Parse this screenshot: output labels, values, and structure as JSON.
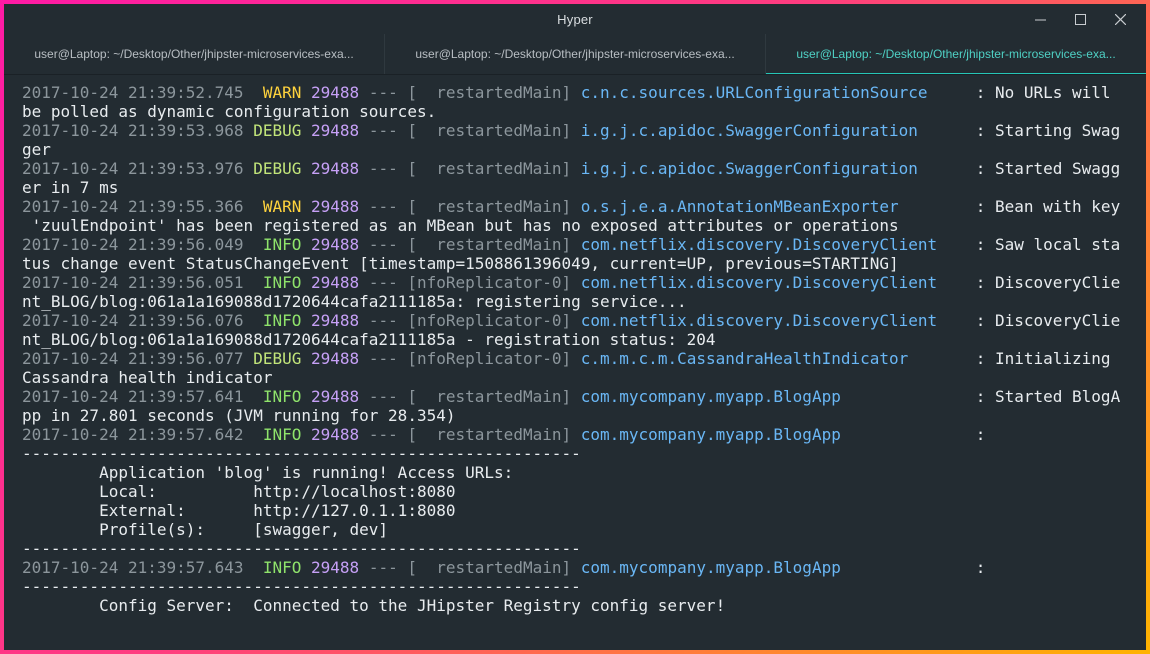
{
  "window": {
    "title": "Hyper",
    "controls": {
      "minimize": "minimize-icon",
      "maximize": "maximize-icon",
      "close": "close-icon"
    }
  },
  "tabs": [
    {
      "label": "user@Laptop: ~/Desktop/Other/jhipster-microservices-exa...",
      "active": false
    },
    {
      "label": "user@Laptop: ~/Desktop/Other/jhipster-microservices-exa...",
      "active": false
    },
    {
      "label": "user@Laptop: ~/Desktop/Other/jhipster-microservices-exa...",
      "active": true
    }
  ],
  "colors": {
    "background": "#232c32",
    "tab_active": "#4fd1c5",
    "warn": "#ffd33d",
    "debug": "#c2e57a",
    "info": "#8fe36b",
    "pid": "#c6a0f6",
    "logger": "#6ab7f5"
  },
  "terminal": {
    "lines": [
      {
        "ts": "2017-10-24 21:39:52.745",
        "level": " WARN",
        "lvlclass": "warn",
        "pid": "29488",
        "sep": " --- [",
        "thread": "  restartedMain]",
        "logger": "c.n.c.sources.URLConfigurationSource",
        "pad": "     ",
        "msg": ": No URLs will"
      },
      {
        "text": "be polled as dynamic configuration sources."
      },
      {
        "ts": "2017-10-24 21:39:53.968",
        "level": "DEBUG",
        "lvlclass": "debug",
        "pid": "29488",
        "sep": " --- [",
        "thread": "  restartedMain]",
        "logger": "i.g.j.c.apidoc.SwaggerConfiguration",
        "pad": "      ",
        "msg": ": Starting Swag"
      },
      {
        "text": "ger"
      },
      {
        "ts": "2017-10-24 21:39:53.976",
        "level": "DEBUG",
        "lvlclass": "debug",
        "pid": "29488",
        "sep": " --- [",
        "thread": "  restartedMain]",
        "logger": "i.g.j.c.apidoc.SwaggerConfiguration",
        "pad": "      ",
        "msg": ": Started Swagg"
      },
      {
        "text": "er in 7 ms"
      },
      {
        "ts": "2017-10-24 21:39:55.366",
        "level": " WARN",
        "lvlclass": "warn",
        "pid": "29488",
        "sep": " --- [",
        "thread": "  restartedMain]",
        "logger": "o.s.j.e.a.AnnotationMBeanExporter",
        "pad": "        ",
        "msg": ": Bean with key"
      },
      {
        "text": " 'zuulEndpoint' has been registered as an MBean but has no exposed attributes or operations"
      },
      {
        "ts": "2017-10-24 21:39:56.049",
        "level": " INFO",
        "lvlclass": "info",
        "pid": "29488",
        "sep": " --- [",
        "thread": "  restartedMain]",
        "logger": "com.netflix.discovery.DiscoveryClient",
        "pad": "    ",
        "msg": ": Saw local sta"
      },
      {
        "text": "tus change event StatusChangeEvent [timestamp=1508861396049, current=UP, previous=STARTING]"
      },
      {
        "ts": "2017-10-24 21:39:56.051",
        "level": " INFO",
        "lvlclass": "info",
        "pid": "29488",
        "sep": " --- [",
        "thread": "nfoReplicator-0]",
        "logger": "com.netflix.discovery.DiscoveryClient",
        "pad": "    ",
        "msg": ": DiscoveryClie"
      },
      {
        "text": "nt_BLOG/blog:061a1a169088d1720644cafa2111185a: registering service..."
      },
      {
        "ts": "2017-10-24 21:39:56.076",
        "level": " INFO",
        "lvlclass": "info",
        "pid": "29488",
        "sep": " --- [",
        "thread": "nfoReplicator-0]",
        "logger": "com.netflix.discovery.DiscoveryClient",
        "pad": "    ",
        "msg": ": DiscoveryClie"
      },
      {
        "text": "nt_BLOG/blog:061a1a169088d1720644cafa2111185a - registration status: 204"
      },
      {
        "ts": "2017-10-24 21:39:56.077",
        "level": "DEBUG",
        "lvlclass": "debug",
        "pid": "29488",
        "sep": " --- [",
        "thread": "nfoReplicator-0]",
        "logger": "c.m.m.c.m.CassandraHealthIndicator",
        "pad": "       ",
        "msg": ": Initializing"
      },
      {
        "text": "Cassandra health indicator"
      },
      {
        "ts": "2017-10-24 21:39:57.641",
        "level": " INFO",
        "lvlclass": "info",
        "pid": "29488",
        "sep": " --- [",
        "thread": "  restartedMain]",
        "logger": "com.mycompany.myapp.BlogApp",
        "pad": "              ",
        "msg": ": Started BlogA"
      },
      {
        "text": "pp in 27.801 seconds (JVM running for 28.354)"
      },
      {
        "ts": "2017-10-24 21:39:57.642",
        "level": " INFO",
        "lvlclass": "info",
        "pid": "29488",
        "sep": " --- [",
        "thread": "  restartedMain]",
        "logger": "com.mycompany.myapp.BlogApp",
        "pad": "              ",
        "msg": ":"
      },
      {
        "text": "----------------------------------------------------------"
      },
      {
        "text": "        Application 'blog' is running! Access URLs:"
      },
      {
        "text": "        Local:          http://localhost:8080"
      },
      {
        "text": "        External:       http://127.0.1.1:8080"
      },
      {
        "text": "        Profile(s):     [swagger, dev]"
      },
      {
        "text": "----------------------------------------------------------"
      },
      {
        "ts": "2017-10-24 21:39:57.643",
        "level": " INFO",
        "lvlclass": "info",
        "pid": "29488",
        "sep": " --- [",
        "thread": "  restartedMain]",
        "logger": "com.mycompany.myapp.BlogApp",
        "pad": "              ",
        "msg": ":"
      },
      {
        "text": "----------------------------------------------------------"
      },
      {
        "text": "        Config Server:  Connected to the JHipster Registry config server!"
      }
    ]
  }
}
